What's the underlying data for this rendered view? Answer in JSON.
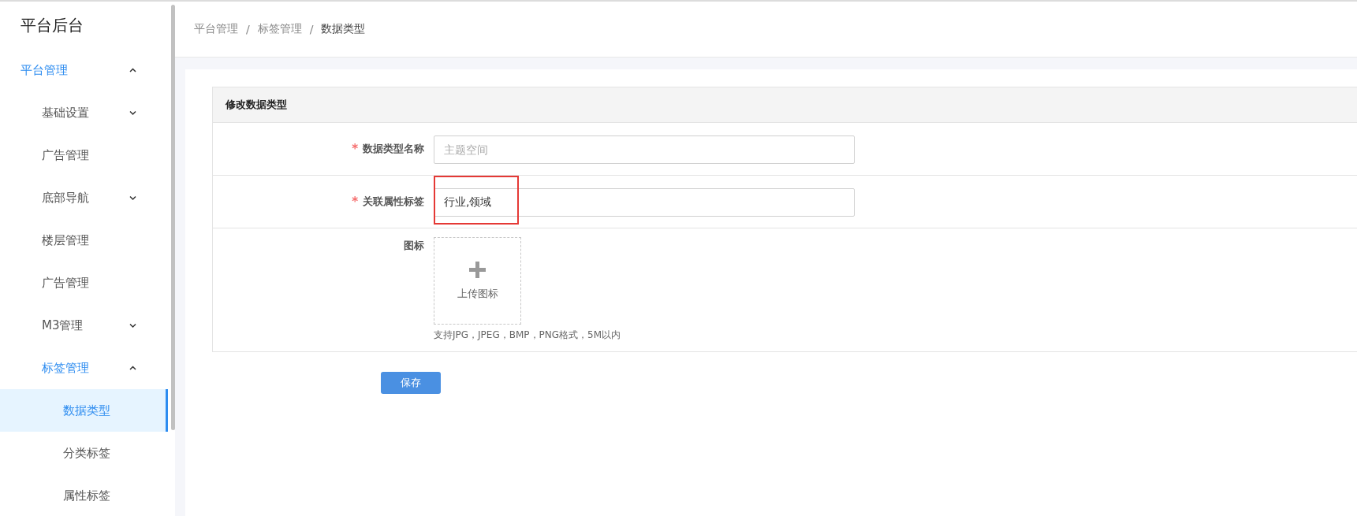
{
  "app_title": "平台后台",
  "sidebar": {
    "items": [
      {
        "label": "平台管理",
        "kind": "group",
        "expanded": true,
        "children": [
          {
            "label": "基础设置",
            "kind": "group",
            "expanded": false
          },
          {
            "label": "广告管理",
            "kind": "item",
            "selected": false
          },
          {
            "label": "底部导航",
            "kind": "group",
            "expanded": false
          },
          {
            "label": "楼层管理",
            "kind": "item",
            "selected": false
          },
          {
            "label": "广告管理",
            "kind": "item",
            "selected": false
          },
          {
            "label": "M3管理",
            "kind": "group",
            "expanded": false
          },
          {
            "label": "标签管理",
            "kind": "group",
            "expanded": true,
            "children": [
              {
                "label": "数据类型",
                "kind": "item",
                "selected": true
              },
              {
                "label": "分类标签",
                "kind": "item",
                "selected": false
              },
              {
                "label": "属性标签",
                "kind": "item",
                "selected": false
              }
            ]
          }
        ]
      }
    ]
  },
  "breadcrumb": [
    "平台管理",
    "标签管理",
    "数据类型"
  ],
  "breadcrumb_separator": "/",
  "form": {
    "title": "修改数据类型",
    "fields": [
      {
        "kind": "text",
        "label": "数据类型名称",
        "required_mark": "*",
        "placeholder": "主题空间",
        "highlighted": false
      },
      {
        "kind": "text",
        "label": "关联属性标签",
        "required_mark": "*",
        "value": "行业,领域",
        "highlighted": true
      },
      {
        "kind": "upload",
        "label": "图标",
        "upload_label": "上传图标",
        "hint": "支持JPG，JPEG，BMP，PNG格式，5M以内"
      }
    ],
    "save_button": "保存"
  }
}
